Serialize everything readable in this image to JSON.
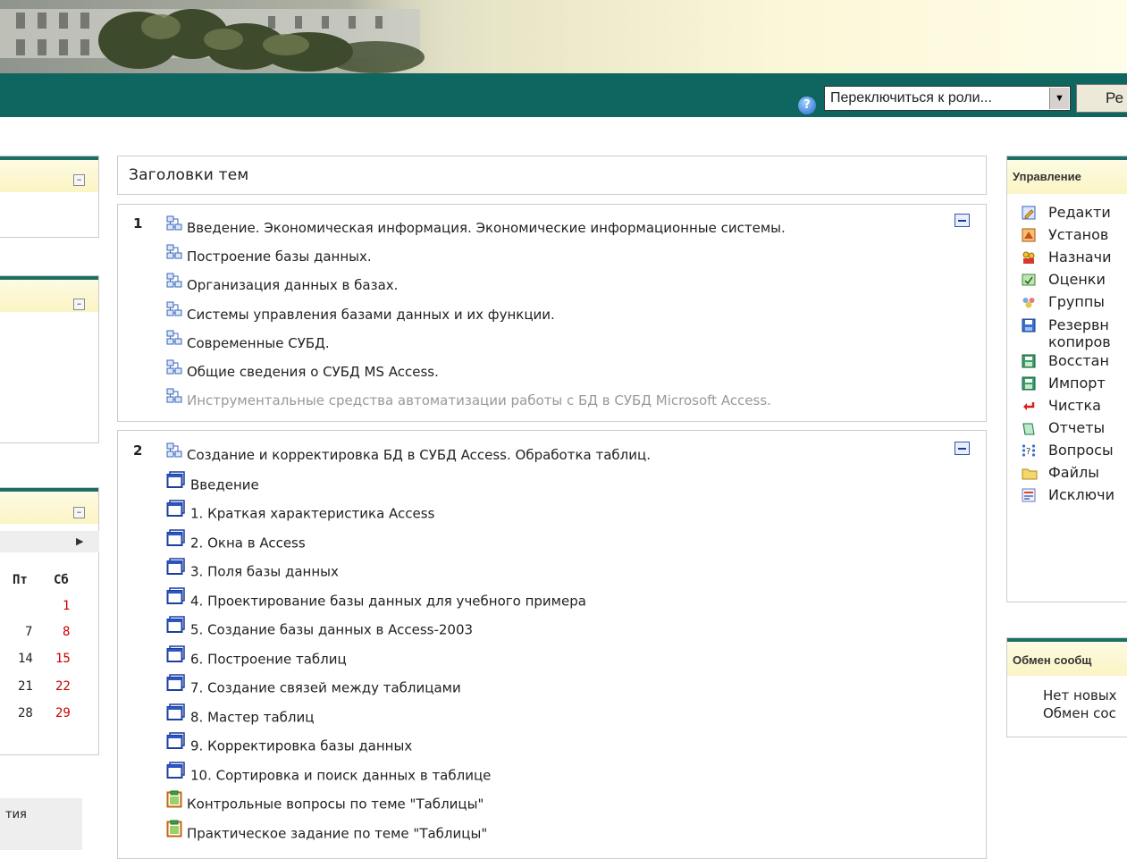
{
  "header": {
    "role_select_value": "Переключиться к роли...",
    "role_button_label": "Ре"
  },
  "left": {
    "calendar": {
      "weekday_headers": [
        "Пт",
        "Сб"
      ],
      "rows": [
        [
          "",
          "1"
        ],
        [
          "7",
          "8"
        ],
        [
          "14",
          "15"
        ],
        [
          "21",
          "22"
        ],
        [
          "28",
          "29"
        ]
      ]
    },
    "events_block_fragment": "тия"
  },
  "main": {
    "topics_title": "Заголовки тем",
    "sections": [
      {
        "number": "1",
        "items": [
          {
            "text": "Введение. Экономическая информация. Экономические информационные системы.",
            "icon": "folder-tree-icon",
            "dimmed": false
          },
          {
            "text": "Построение базы данных.",
            "icon": "folder-tree-icon",
            "dimmed": false
          },
          {
            "text": "Организация данных в базах.",
            "icon": "folder-tree-icon",
            "dimmed": false
          },
          {
            "text": "Системы управления базами данных и их функции.",
            "icon": "folder-tree-icon",
            "dimmed": false
          },
          {
            "text": "Современные СУБД.",
            "icon": "folder-tree-icon",
            "dimmed": false
          },
          {
            "text": "Общие сведения о СУБД MS Access.",
            "icon": "folder-tree-icon",
            "dimmed": false
          },
          {
            "text": "Инструментальные средства автоматизации работы с БД в СУБД Microsoft Access.",
            "icon": "folder-tree-icon",
            "dimmed": true
          }
        ]
      },
      {
        "number": "2",
        "items": [
          {
            "text": "Создание и корректировка БД в СУБД Access. Обработка таблиц.",
            "icon": "folder-tree-icon",
            "dimmed": false
          },
          {
            "text": "Введение",
            "icon": "window-icon",
            "dimmed": false
          },
          {
            "text": "1. Краткая характеристика Access",
            "icon": "window-icon",
            "dimmed": false
          },
          {
            "text": "2. Окна в Access",
            "icon": "window-icon",
            "dimmed": false
          },
          {
            "text": "3. Поля базы данных",
            "icon": "window-icon",
            "dimmed": false
          },
          {
            "text": "4. Проектирование базы данных для учебного примера",
            "icon": "window-icon",
            "dimmed": false
          },
          {
            "text": "5. Создание базы данных в Access-2003",
            "icon": "window-icon",
            "dimmed": false
          },
          {
            "text": "6. Построение таблиц",
            "icon": "window-icon",
            "dimmed": false
          },
          {
            "text": "7. Создание связей между таблицами",
            "icon": "window-icon",
            "dimmed": false
          },
          {
            "text": "8. Мастер таблиц",
            "icon": "window-icon",
            "dimmed": false
          },
          {
            "text": "9. Корректировка базы данных",
            "icon": "window-icon",
            "dimmed": false
          },
          {
            "text": "10. Сортировка и поиск данных в таблице",
            "icon": "window-icon",
            "dimmed": false
          },
          {
            "text": "Контрольные вопросы по теме \"Таблицы\"",
            "icon": "clipboard-icon",
            "dimmed": false
          },
          {
            "text": "Практическое задание по теме \"Таблицы\"",
            "icon": "clipboard-icon",
            "dimmed": false
          }
        ]
      }
    ]
  },
  "right": {
    "admin": {
      "title": "Управление",
      "items": [
        {
          "label": "Редакти",
          "icon": "edit-icon"
        },
        {
          "label": "Установ",
          "icon": "settings-icon"
        },
        {
          "label": "Назначи",
          "icon": "assign-roles-icon"
        },
        {
          "label": "Оценки",
          "icon": "grades-icon"
        },
        {
          "label": "Группы",
          "icon": "groups-icon"
        },
        {
          "label": "Резервн",
          "label2": "копиров",
          "icon": "backup-icon"
        },
        {
          "label": "Восстан",
          "icon": "restore-icon"
        },
        {
          "label": "Импорт",
          "icon": "import-icon"
        },
        {
          "label": "Чистка",
          "icon": "reset-icon"
        },
        {
          "label": "Отчеты",
          "icon": "reports-icon"
        },
        {
          "label": "Вопросы",
          "icon": "questions-icon"
        },
        {
          "label": "Файлы",
          "icon": "files-icon"
        },
        {
          "label": "Исключи",
          "icon": "unenrol-icon"
        }
      ]
    },
    "messages": {
      "title": "Обмен сообщ",
      "line1": "Нет новых",
      "line2": "Обмен сос"
    }
  },
  "colors": {
    "header_bar": "#0f6660",
    "block_header_bg": "#fbf4c4",
    "link_text": "#222222",
    "dimmed_text": "#999999",
    "weekend": "#cc0000"
  }
}
